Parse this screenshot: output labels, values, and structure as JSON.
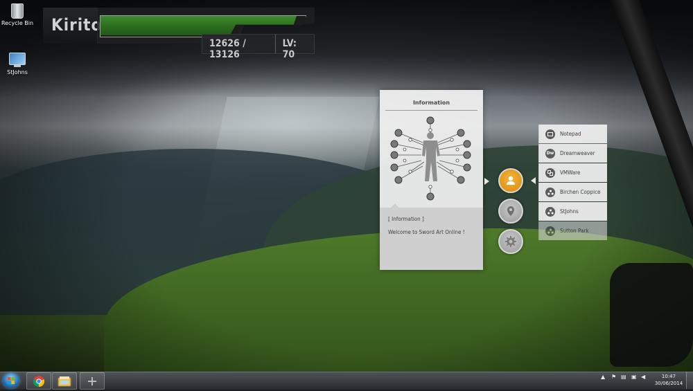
{
  "desktop": {
    "icons": [
      {
        "label": "Recycle Bin"
      },
      {
        "label": "StJohns"
      }
    ]
  },
  "hud": {
    "player_name": "Kirito",
    "hp_current": "12626",
    "hp_separator": "/",
    "hp_max": "13126",
    "level_text": "LV: 70",
    "hp_fraction": 0.962,
    "bar_color": "#2f7a22"
  },
  "info_panel": {
    "title": "Information",
    "line1": "[ Information ]",
    "line2": "Welcome to Sword Art Online !"
  },
  "side_menu": {
    "buttons": [
      {
        "icon": "person-icon",
        "state": "active"
      },
      {
        "icon": "location-pin-icon",
        "state": "idle"
      },
      {
        "icon": "gear-icon",
        "state": "idle"
      }
    ],
    "accent_color": "#e39a1c"
  },
  "app_list": [
    {
      "label": "Notepad",
      "icon": "notepad-icon",
      "icon_text": ""
    },
    {
      "label": "Dreamweaver",
      "icon": "dreamweaver-icon",
      "icon_text": "Dw"
    },
    {
      "label": "VMWare",
      "icon": "vmware-icon",
      "icon_text": ""
    },
    {
      "label": "Birchen Coppice",
      "icon": "network-icon",
      "icon_text": ""
    },
    {
      "label": "StJohns",
      "icon": "network-icon",
      "icon_text": ""
    },
    {
      "label": "Sutton Park",
      "icon": "network-icon",
      "icon_text": ""
    }
  ],
  "taskbar": {
    "pinned": [
      "chrome-icon",
      "file-explorer-icon",
      "add-icon"
    ],
    "clock_time": "10:47",
    "clock_date": "30/06/2014"
  }
}
